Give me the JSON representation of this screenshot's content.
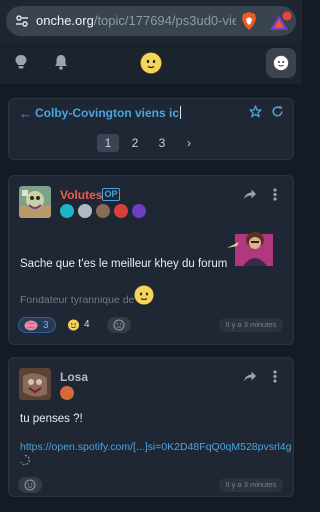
{
  "browser": {
    "url_domain": "onche.org",
    "url_path": "/topic/177694/ps3ud0-vien"
  },
  "topic": {
    "back_arrow": "←",
    "title": "Colby-Covington viens ic",
    "pages": [
      "1",
      "2",
      "3"
    ],
    "current_page": "1",
    "next": "›"
  },
  "posts": [
    {
      "author": "Volutes",
      "author_color": "#f05a4f",
      "op_badge": "OP",
      "text": "Sache que t'es le meilleur khey du forum",
      "signature": "Fondateur tyrannique de",
      "reactions": [
        {
          "icon": "brain-emoji",
          "count": "3"
        },
        {
          "icon": "smiley-emoji",
          "count": "4"
        }
      ],
      "timestamp": "Il y a 3 minutes"
    },
    {
      "author": "Losa",
      "author_color": "#b4bcc6",
      "text": "tu penses ?!",
      "link": "https://open.spotify.com/[...]si=0K2D48FqQ0qM528pvsrl4g",
      "timestamp": "Il y a 3 minutes"
    }
  ]
}
